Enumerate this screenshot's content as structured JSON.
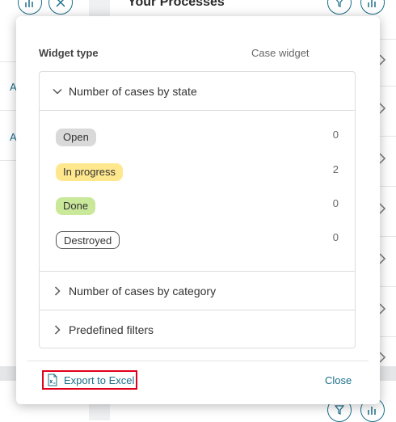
{
  "background": {
    "page_title": "Your Processes",
    "left_panel_letters": [
      "A",
      "A"
    ]
  },
  "modal": {
    "widget_type_label": "Widget type",
    "widget_type_value": "Case widget",
    "sections": {
      "by_state": {
        "label": "Number of cases by state",
        "expanded": true,
        "states": [
          {
            "label": "Open",
            "count": "0",
            "color": "#d9d9d9"
          },
          {
            "label": "In progress",
            "count": "2",
            "color": "#ffe78d"
          },
          {
            "label": "Done",
            "count": "0",
            "color": "#c9e89a"
          },
          {
            "label": "Destroyed",
            "count": "0",
            "color": "#ffffff"
          }
        ]
      },
      "by_category": {
        "label": "Number of cases by category",
        "expanded": false
      },
      "predefined_filters": {
        "label": "Predefined filters",
        "expanded": false
      }
    },
    "footer": {
      "export_label": "Export to Excel",
      "export_icon": "excel-file-icon",
      "close_label": "Close"
    }
  },
  "colors": {
    "accent": "#1b6f8a",
    "highlight_border": "#e0001b"
  }
}
